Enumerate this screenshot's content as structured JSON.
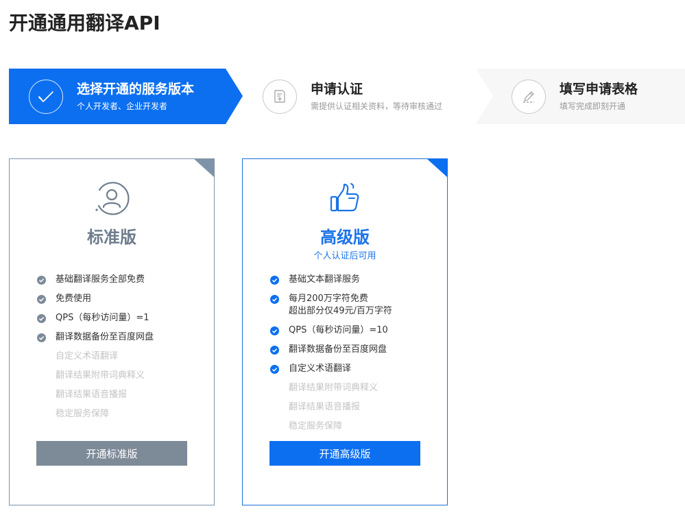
{
  "page": {
    "title": "开通通用翻译API"
  },
  "steps": [
    {
      "title": "选择开通的服务版本",
      "sub": "个人开发者、企业开发者"
    },
    {
      "title": "申请认证",
      "sub": "需提供认证相关资料，等待审核通过"
    },
    {
      "title": "填写申请表格",
      "sub": "填写完成即刻开通"
    }
  ],
  "cards": {
    "standard": {
      "name": "标准版",
      "button": "开通标准版",
      "features": [
        {
          "text": "基础翻译服务全部免费",
          "enabled": true
        },
        {
          "text": "免费使用",
          "enabled": true
        },
        {
          "text": "QPS（每秒访问量）=1",
          "enabled": true
        },
        {
          "text": "翻译数据备份至百度网盘",
          "enabled": true
        },
        {
          "text": "自定义术语翻译",
          "enabled": false
        },
        {
          "text": "翻译结果附带词典释义",
          "enabled": false
        },
        {
          "text": "翻译结果语音播报",
          "enabled": false
        },
        {
          "text": "稳定服务保障",
          "enabled": false
        }
      ]
    },
    "premium": {
      "name": "高级版",
      "note": "个人认证后可用",
      "button": "开通高级版",
      "features": [
        {
          "text": "基础文本翻译服务",
          "enabled": true
        },
        {
          "text": "每月200万字符免费",
          "text2": "超出部分仅49元/百万字符",
          "enabled": true
        },
        {
          "text": "QPS（每秒访问量）=10",
          "enabled": true
        },
        {
          "text": "翻译数据备份至百度网盘",
          "enabled": true
        },
        {
          "text": "自定义术语翻译",
          "enabled": true
        },
        {
          "text": "翻译结果附带词典释义",
          "enabled": false
        },
        {
          "text": "翻译结果语音播报",
          "enabled": false
        },
        {
          "text": "稳定服务保障",
          "enabled": false
        }
      ]
    }
  },
  "colors": {
    "accent": "#0b6ff0",
    "standard": "#7d8a98",
    "disabled": "#c4c4c4",
    "step_inactive_bg": "#f7f7f7"
  }
}
